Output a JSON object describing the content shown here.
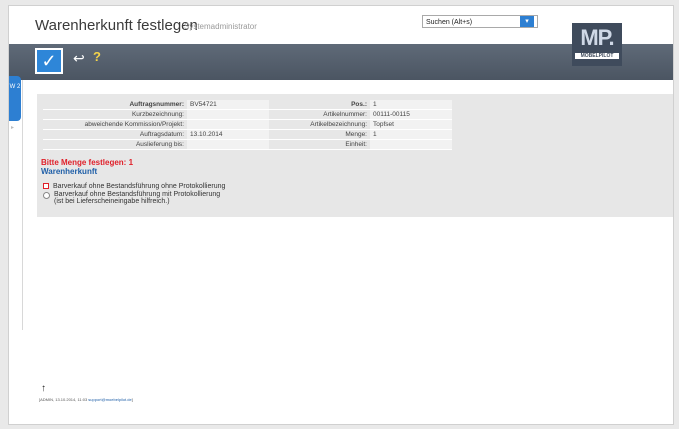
{
  "header": {
    "title": "Warenherkunft festlegen",
    "subtitle": "Systemadministrator",
    "search_value": "Suchen (Alt+s)",
    "search_button": "▾"
  },
  "logo": {
    "mark": "MP.",
    "name": "MÖBELPILOT"
  },
  "toolbar": {
    "confirm_icon": "✓",
    "back_icon": "↩",
    "help_icon": "?"
  },
  "side_tab": {
    "label": "W 2"
  },
  "info": {
    "rows": [
      {
        "l1": "Auftragsnummer:",
        "v1": "BV54721",
        "l2": "Pos.:",
        "v2": "1"
      },
      {
        "l1": "Kurzbezeichnung:",
        "v1": "",
        "l2": "Artikelnummer:",
        "v2": "00111-00115"
      },
      {
        "l1": "abweichende Kommission/Projekt:",
        "v1": "",
        "l2": "Artikelbezeichnung:",
        "v2": "Topfset"
      },
      {
        "l1": "Auftragsdatum:",
        "v1": "13.10.2014",
        "l2": "Menge:",
        "v2": "1"
      },
      {
        "l1": "Auslieferung bis:",
        "v1": "",
        "l2": "Einheit:",
        "v2": ""
      }
    ]
  },
  "messages": {
    "error": "Bitte Menge festlegen: 1",
    "section": "Warenherkunft"
  },
  "options": {
    "opt1": "Barverkauf ohne Bestandsführung ohne Protokollierung",
    "opt2_line1": "Barverkauf ohne Bestandsführung mit Protokollierung",
    "opt2_line2": "(ist bei Lieferscheineingabe hilfreich.)"
  },
  "footer": {
    "up_icon": "↑",
    "text": "[ADMIN, 13.10.2014, 11:03 ",
    "link": "support@moebelpilot.de",
    "suffix": "]"
  },
  "colors": {
    "accent": "#2d7fd2",
    "error": "#e0202a",
    "section": "#1f5fa8",
    "toolbar": "#56606d"
  }
}
